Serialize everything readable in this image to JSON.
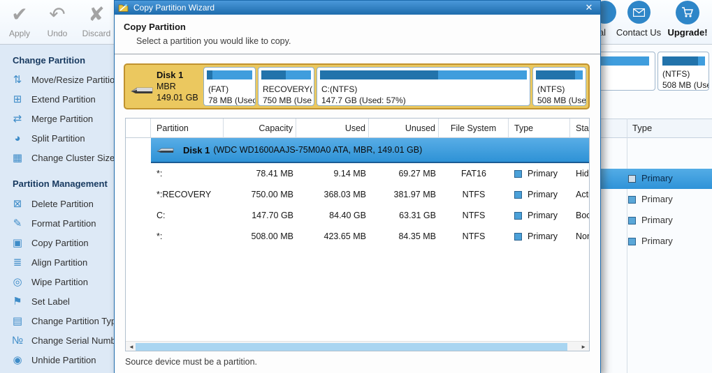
{
  "window": {
    "title": "Copy Partition Wizard"
  },
  "toolbar": {
    "apply": "Apply",
    "undo": "Undo",
    "discard": "Discard",
    "partial_label": "al",
    "contact": "Contact Us",
    "upgrade": "Upgrade!"
  },
  "icons": {
    "apply": "✔",
    "undo": "↶",
    "discard": "✘",
    "move_resize": "⇅",
    "extend": "⊞",
    "merge": "⇄",
    "split": "◕",
    "cluster_size": "▦",
    "delete": "⊠",
    "format": "✎",
    "copy": "▣",
    "align": "≣",
    "wipe": "◎",
    "set_label": "⚑",
    "partition_type": "▤",
    "serial_number": "№",
    "unhide": "◉",
    "scroll_left": "◄",
    "scroll_right": "►",
    "close": "✕"
  },
  "sidebar": {
    "section1": {
      "title": "Change Partition",
      "items": [
        {
          "label": "Move/Resize Partition"
        },
        {
          "label": "Extend Partition"
        },
        {
          "label": "Merge Partition"
        },
        {
          "label": "Split Partition"
        },
        {
          "label": "Change Cluster Size"
        }
      ]
    },
    "section2": {
      "title": "Partition Management",
      "items": [
        {
          "label": "Delete Partition"
        },
        {
          "label": "Format Partition"
        },
        {
          "label": "Copy Partition"
        },
        {
          "label": "Align Partition"
        },
        {
          "label": "Wipe Partition"
        },
        {
          "label": "Set Label"
        },
        {
          "label": "Change Partition Type"
        },
        {
          "label": "Change Serial Number"
        },
        {
          "label": "Unhide Partition"
        }
      ]
    }
  },
  "dialog": {
    "title": "Copy Partition Wizard",
    "heading": "Copy Partition",
    "subtitle": "Select a partition you would like to copy.",
    "footer_note": "Source device must be a partition.",
    "disk": {
      "name": "Disk 1",
      "style": "MBR",
      "size": "149.01 GB"
    },
    "partitions": [
      {
        "label": "(FAT)",
        "size_line": "78 MB (Used",
        "used_pct": 12
      },
      {
        "label": "RECOVERY(",
        "size_line": "750 MB (Use",
        "used_pct": 49
      },
      {
        "label": "C:(NTFS)",
        "size_line": "147.7 GB (Used: 57%)",
        "used_pct": 57
      },
      {
        "label": "(NTFS)",
        "size_line": "508 MB (Use",
        "used_pct": 83
      }
    ],
    "table": {
      "columns": [
        "Partition",
        "Capacity",
        "Used",
        "Unused",
        "File System",
        "Type",
        "Status"
      ],
      "disk_row": {
        "name": "Disk 1",
        "details": "(WDC WD1600AAJS-75M0A0 ATA, MBR, 149.01 GB)"
      },
      "rows": [
        {
          "partition": "*:",
          "capacity": "78.41 MB",
          "used": "9.14 MB",
          "unused": "69.27 MB",
          "fs": "FAT16",
          "type": "Primary",
          "status": "Hidden"
        },
        {
          "partition": "*:RECOVERY",
          "capacity": "750.00 MB",
          "used": "368.03 MB",
          "unused": "381.97 MB",
          "fs": "NTFS",
          "type": "Primary",
          "status": "Active"
        },
        {
          "partition": "C:",
          "capacity": "147.70 GB",
          "used": "84.40 GB",
          "unused": "63.31 GB",
          "fs": "NTFS",
          "type": "Primary",
          "status": "Boot"
        },
        {
          "partition": "*:",
          "capacity": "508.00 MB",
          "used": "423.65 MB",
          "unused": "84.35 MB",
          "fs": "NTFS",
          "type": "Primary",
          "status": "Normal"
        }
      ]
    }
  },
  "background": {
    "partition_block": {
      "label": "(NTFS)",
      "size_line": "508 MB (Use",
      "used_pct": 83
    },
    "table": {
      "type_header": "Type",
      "rows": [
        {
          "type": "Primary",
          "selected": true
        },
        {
          "type": "Primary",
          "selected": false
        },
        {
          "type": "Primary",
          "selected": false
        },
        {
          "type": "Primary",
          "selected": false
        }
      ]
    }
  },
  "colors": {
    "titlebar_blue": "#2878bc",
    "panel_yellow": "#ebc85f",
    "panel_border": "#c0922e",
    "bar_used": "#2273ab",
    "bar_free": "#3f9ddd",
    "row_selected": "#45a6e6",
    "circle_button": "#2e86c8",
    "sidebar_bg": "#dde9f6"
  }
}
